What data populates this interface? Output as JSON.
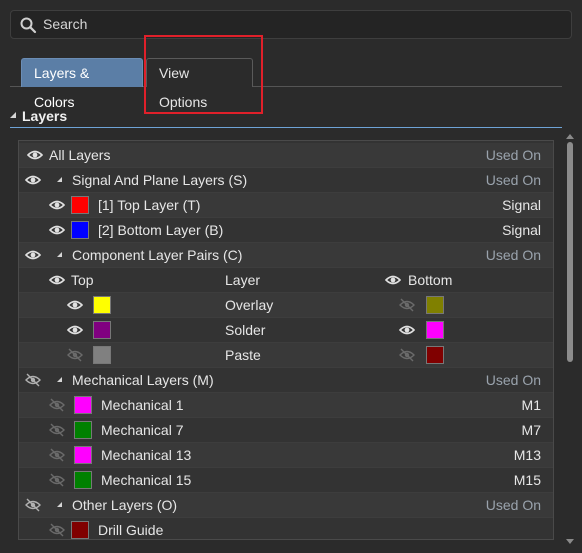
{
  "search": {
    "placeholder": "Search"
  },
  "tabs": [
    {
      "label": "Layers & Colors",
      "active": true
    },
    {
      "label": "View Options",
      "active": false
    }
  ],
  "section": {
    "title": "Layers"
  },
  "layers": {
    "all": {
      "label": "All Layers",
      "status": "Used On"
    },
    "signal_group": {
      "label": "Signal And Plane Layers (S)",
      "status": "Used On"
    },
    "signal_layers": [
      {
        "label": "[1] Top Layer (T)",
        "type": "Signal",
        "color": "#ff0000",
        "visible": true
      },
      {
        "label": "[2] Bottom Layer (B)",
        "type": "Signal",
        "color": "#0000ff",
        "visible": true
      }
    ],
    "component_group": {
      "label": "Component Layer Pairs (C)",
      "status": "Used On"
    },
    "pair_header": {
      "top": "Top",
      "layer": "Layer",
      "bottom": "Bottom"
    },
    "pairs": [
      {
        "name": "Overlay",
        "top_color": "#ffff00",
        "top_visible": true,
        "bottom_color": "#808000",
        "bottom_visible": false
      },
      {
        "name": "Solder",
        "top_color": "#800080",
        "top_visible": true,
        "bottom_color": "#ff00ff",
        "bottom_visible": true
      },
      {
        "name": "Paste",
        "top_color": "#808080",
        "top_visible": false,
        "bottom_color": "#800000",
        "bottom_visible": false
      }
    ],
    "mechanical_group": {
      "label": "Mechanical Layers (M)",
      "status": "Used On"
    },
    "mechanical_layers": [
      {
        "label": "Mechanical 1",
        "code": "M1",
        "color": "#ff00ff",
        "visible": false
      },
      {
        "label": "Mechanical 7",
        "code": "M7",
        "color": "#008000",
        "visible": false
      },
      {
        "label": "Mechanical 13",
        "code": "M13",
        "color": "#ff00ff",
        "visible": false
      },
      {
        "label": "Mechanical 15",
        "code": "M15",
        "color": "#008000",
        "visible": false
      }
    ],
    "other_group": {
      "label": "Other Layers (O)",
      "status": "Used On"
    },
    "other_layers": [
      {
        "label": "Drill Guide",
        "color": "#800000",
        "visible": false
      }
    ]
  },
  "colors": {
    "accent": "#5b7ea6",
    "highlight_box": "#e0202a",
    "used_on_text": "#9aa3ad"
  }
}
